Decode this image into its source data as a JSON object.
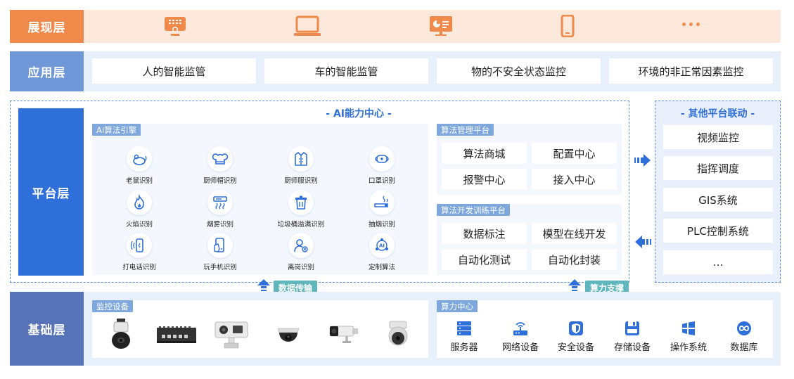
{
  "layers": {
    "presentation": "展现层",
    "application": "应用层",
    "platform": "平台层",
    "foundation": "基础层"
  },
  "presentation_icons": [
    "video-wall-icon",
    "laptop-icon",
    "dashboard-screen-icon",
    "mobile-phone-icon",
    "more-icon"
  ],
  "more_label": "•••",
  "applications": [
    "人的智能监管",
    "车的智能监管",
    "物的不安全状态监控",
    "环境的非正常因素监控"
  ],
  "ai_center": {
    "title": "- AI能力中心 -",
    "engine_label": "AI算法引擎",
    "algorithms": [
      {
        "label": "老鼠识别",
        "icon": "mouse-icon"
      },
      {
        "label": "厨师帽识别",
        "icon": "chef-hat-icon"
      },
      {
        "label": "厨师服识别",
        "icon": "chef-uniform-icon"
      },
      {
        "label": "口罩识别",
        "icon": "mask-icon"
      },
      {
        "label": "火焰识别",
        "icon": "fire-icon"
      },
      {
        "label": "烟雾识别",
        "icon": "smoke-icon"
      },
      {
        "label": "垃圾桶溢满识别",
        "icon": "trash-bin-icon"
      },
      {
        "label": "抽烟识别",
        "icon": "cigarette-icon"
      },
      {
        "label": "打电话识别",
        "icon": "phone-call-icon"
      },
      {
        "label": "玩手机识别",
        "icon": "phone-play-icon"
      },
      {
        "label": "离岗识别",
        "icon": "leave-post-icon"
      },
      {
        "label": "定制算法",
        "icon": "custom-ai-icon"
      }
    ],
    "management": {
      "label": "算法管理平台",
      "items": [
        "算法商城",
        "配置中心",
        "报警中心",
        "接入中心"
      ]
    },
    "training": {
      "label": "算法开发训练平台",
      "items": [
        "数据标注",
        "模型在线开发",
        "自动化测试",
        "自动化封装"
      ]
    }
  },
  "other_platforms": {
    "title": "- 其他平台联动 -",
    "items": [
      "视频监控",
      "指挥调度",
      "GIS系统",
      "PLC控制系统",
      "…"
    ]
  },
  "transfer_labels": {
    "data": "数据传输",
    "compute": "算力支撑"
  },
  "monitoring": {
    "label": "监控设备",
    "devices": [
      "ptz-dome-camera-icon",
      "nvr-box-icon",
      "thermal-camera-icon",
      "dome-camera-icon",
      "bullet-camera-icon",
      "speed-dome-camera-icon"
    ]
  },
  "compute_center": {
    "label": "算力中心",
    "items": [
      {
        "label": "服务器",
        "icon": "server-icon"
      },
      {
        "label": "网络设备",
        "icon": "network-device-icon"
      },
      {
        "label": "安全设备",
        "icon": "security-shield-icon"
      },
      {
        "label": "存储设备",
        "icon": "storage-icon"
      },
      {
        "label": "操作系统",
        "icon": "os-windows-icon"
      },
      {
        "label": "数据库",
        "icon": "database-icon"
      }
    ]
  },
  "colors": {
    "presentation": "#f08a4b",
    "application": "#6f98d8",
    "platform": "#2e6fd9",
    "foundation": "#5673b8",
    "accent": "#2e6fd9"
  }
}
